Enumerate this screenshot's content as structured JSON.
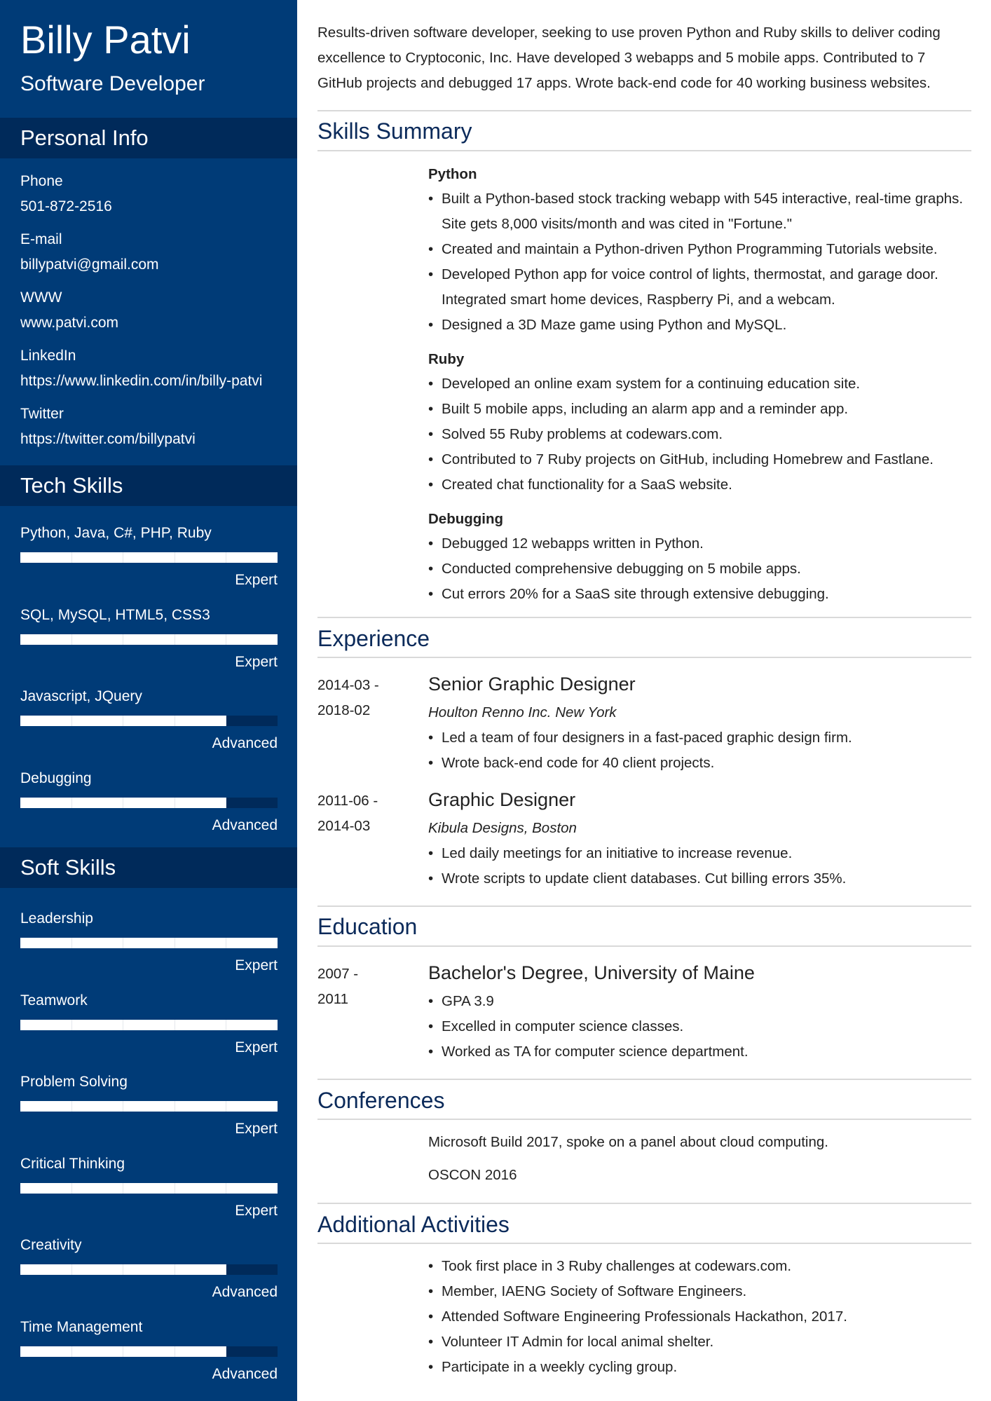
{
  "header": {
    "name": "Billy Patvi",
    "title": "Software Developer"
  },
  "sidebar": {
    "personal_info": {
      "heading": "Personal Info",
      "items": [
        {
          "label": "Phone",
          "value": "501-872-2516"
        },
        {
          "label": "E-mail",
          "value": "billypatvi@gmail.com"
        },
        {
          "label": "WWW",
          "value": "www.patvi.com"
        },
        {
          "label": "LinkedIn",
          "value": "https://www.linkedin.com/in/billy-patvi"
        },
        {
          "label": "Twitter",
          "value": "https://twitter.com/billypatvi"
        }
      ]
    },
    "tech_skills": {
      "heading": "Tech Skills",
      "items": [
        {
          "name": "Python, Java, C#, PHP, Ruby",
          "level": "Expert",
          "rating": 5,
          "max": 5
        },
        {
          "name": "SQL, MySQL, HTML5, CSS3",
          "level": "Expert",
          "rating": 5,
          "max": 5
        },
        {
          "name": "Javascript, JQuery",
          "level": "Advanced",
          "rating": 4,
          "max": 5
        },
        {
          "name": "Debugging",
          "level": "Advanced",
          "rating": 4,
          "max": 5
        }
      ]
    },
    "soft_skills": {
      "heading": "Soft Skills",
      "items": [
        {
          "name": "Leadership",
          "level": "Expert",
          "rating": 5,
          "max": 5
        },
        {
          "name": "Teamwork",
          "level": "Expert",
          "rating": 5,
          "max": 5
        },
        {
          "name": "Problem Solving",
          "level": "Expert",
          "rating": 5,
          "max": 5
        },
        {
          "name": "Critical Thinking",
          "level": "Expert",
          "rating": 5,
          "max": 5
        },
        {
          "name": "Creativity",
          "level": "Advanced",
          "rating": 4,
          "max": 5
        },
        {
          "name": "Time Management",
          "level": "Advanced",
          "rating": 4,
          "max": 5
        }
      ]
    }
  },
  "main": {
    "summary": "Results-driven software developer, seeking to use proven Python and Ruby skills to deliver coding excellence to Cryptoconic, Inc. Have developed 3 webapps and 5 mobile apps. Contributed to 7 GitHub projects and debugged 17 apps. Wrote back-end code for 40 working business websites.",
    "skills_summary": {
      "heading": "Skills Summary",
      "groups": [
        {
          "title": "Python",
          "bullets": [
            "Built a Python-based stock tracking webapp with 545 interactive, real-time graphs. Site gets 8,000 visits/month and was cited in \"Fortune.\"",
            "Created and maintain a Python-driven Python Programming Tutorials website.",
            "Developed Python app for voice control of lights, thermostat, and garage door. Integrated smart home devices, Raspberry Pi, and a webcam.",
            "Designed a 3D Maze game using Python and MySQL."
          ]
        },
        {
          "title": "Ruby",
          "bullets": [
            "Developed an online exam system for a continuing education site.",
            "Built 5 mobile apps, including an alarm app and a reminder app.",
            "Solved 55 Ruby problems at codewars.com.",
            "Contributed to 7 Ruby projects on GitHub, including Homebrew and Fastlane.",
            "Created chat functionality for a SaaS website."
          ]
        },
        {
          "title": "Debugging",
          "bullets": [
            "Debugged 12 webapps written in Python.",
            "Conducted comprehensive debugging on 5 mobile apps.",
            "Cut errors 20% for a SaaS site through extensive debugging."
          ]
        }
      ]
    },
    "experience": {
      "heading": "Experience",
      "jobs": [
        {
          "date_start": "2014-03 -",
          "date_end": "2018-02",
          "title": "Senior Graphic Designer",
          "company": "Houlton Renno Inc. New York",
          "bullets": [
            "Led a team of four designers in a fast-paced graphic design firm.",
            "Wrote back-end code for 40 client projects."
          ]
        },
        {
          "date_start": "2011-06 -",
          "date_end": "2014-03",
          "title": "Graphic Designer",
          "company": "Kibula Designs, Boston",
          "bullets": [
            "Led daily meetings for an initiative to increase revenue.",
            "Wrote scripts to update client databases. Cut billing errors 35%."
          ]
        }
      ]
    },
    "education": {
      "heading": "Education",
      "entries": [
        {
          "date_start": "2007 -",
          "date_end": "2011",
          "title": "Bachelor's Degree, University of Maine",
          "bullets": [
            "GPA 3.9",
            "Excelled in computer science classes.",
            "Worked as TA for computer science department."
          ]
        }
      ]
    },
    "conferences": {
      "heading": "Conferences",
      "items": [
        "Microsoft Build 2017, spoke on a panel about cloud computing.",
        "OSCON 2016"
      ]
    },
    "additional_activities": {
      "heading": "Additional Activities",
      "bullets": [
        "Took first place in 3 Ruby challenges at codewars.com.",
        "Member, IAENG Society of Software Engineers.",
        "Attended Software Engineering Professionals Hackathon, 2017.",
        "Volunteer IT Admin for local animal shelter.",
        "Participate in a weekly cycling group."
      ]
    }
  }
}
